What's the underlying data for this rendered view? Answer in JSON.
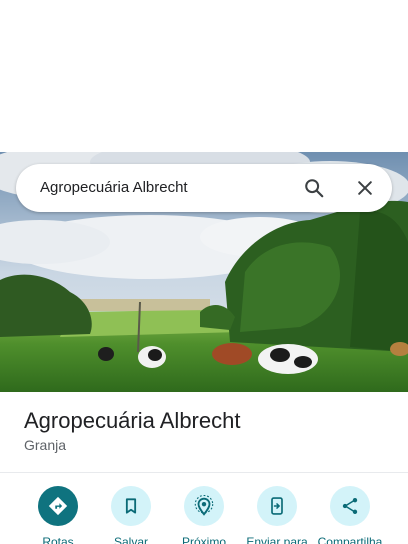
{
  "search": {
    "query": "Agropecuária Albrecht",
    "search_icon": "search-icon",
    "close_icon": "close-icon"
  },
  "place": {
    "name": "Agropecuária Albrecht",
    "category": "Granja"
  },
  "actions": [
    {
      "label": "Rotas",
      "icon": "directions-icon"
    },
    {
      "label": "Salvar",
      "icon": "bookmark-icon"
    },
    {
      "label": "Próximo",
      "icon": "nearby-icon"
    },
    {
      "label": "Enviar para",
      "icon": "send-to-phone-icon"
    },
    {
      "label": "Compartilha",
      "icon": "share-icon"
    }
  ],
  "colors": {
    "accent": "#0f737f",
    "action_bg": "#d3f3f9",
    "action_label": "#0b6b77",
    "title": "#202124",
    "subtitle": "#5f6368"
  }
}
